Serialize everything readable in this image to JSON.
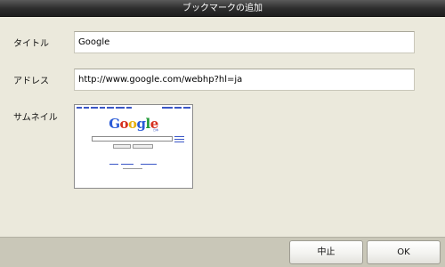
{
  "dialog": {
    "title": "ブックマークの追加"
  },
  "form": {
    "title_label": "タイトル",
    "title_value": "Google",
    "address_label": "アドレス",
    "address_value": "http://www.google.com/webhp?hl=ja",
    "thumbnail_label": "サムネイル"
  },
  "thumbnail": {
    "logo_letters": [
      {
        "char": "G",
        "color": "#2a5bd7"
      },
      {
        "char": "o",
        "color": "#d6301f"
      },
      {
        "char": "o",
        "color": "#e8b00d"
      },
      {
        "char": "g",
        "color": "#2a5bd7"
      },
      {
        "char": "l",
        "color": "#1f9a35"
      },
      {
        "char": "e",
        "color": "#d6301f"
      }
    ],
    "logo_sub": "日本",
    "search_button": "Google 検索",
    "lucky_button": "I'm Feeling Lucky"
  },
  "buttons": {
    "cancel": "中止",
    "ok": "OK"
  },
  "colors": {
    "titlebar": "#2c2c2c",
    "background": "#ebe9dc",
    "footer": "#c9c7b8",
    "link": "#3a56c6"
  }
}
